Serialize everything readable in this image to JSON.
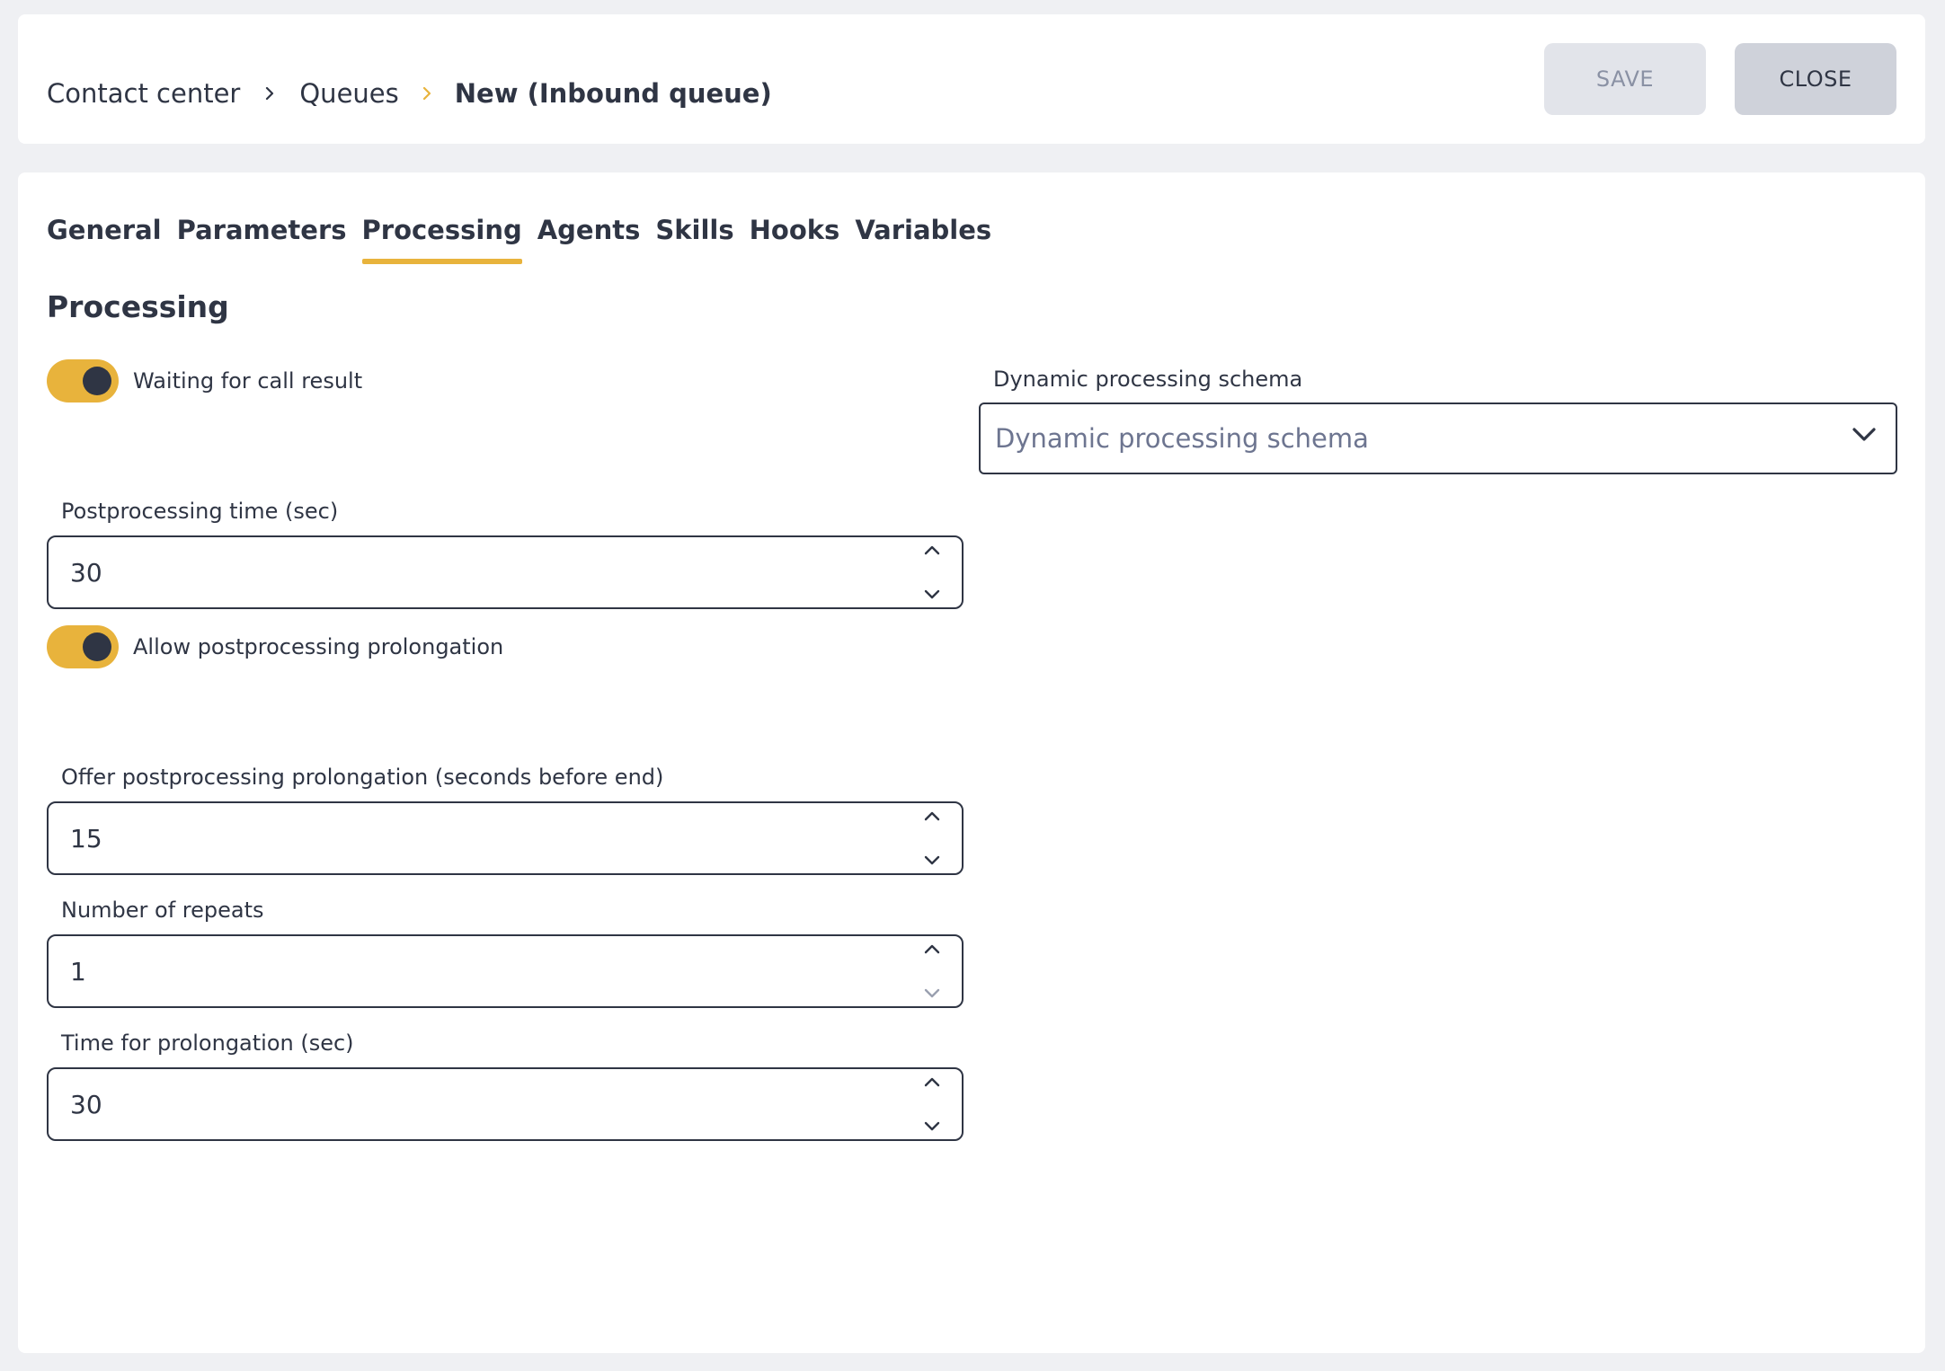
{
  "breadcrumb": {
    "items": [
      "Contact center",
      "Queues",
      "New (Inbound queue)"
    ]
  },
  "header": {
    "save_label": "SAVE",
    "close_label": "CLOSE"
  },
  "tabs": [
    {
      "label": "General",
      "active": false
    },
    {
      "label": "Parameters",
      "active": false
    },
    {
      "label": "Processing",
      "active": true
    },
    {
      "label": "Agents",
      "active": false
    },
    {
      "label": "Skills",
      "active": false
    },
    {
      "label": "Hooks",
      "active": false
    },
    {
      "label": "Variables",
      "active": false
    }
  ],
  "processing": {
    "title": "Processing",
    "waiting_toggle": {
      "label": "Waiting for call result",
      "on": true
    },
    "dynamic_schema": {
      "label": "Dynamic processing schema",
      "placeholder": "Dynamic processing schema"
    },
    "postprocessing_time": {
      "label": "Postprocessing time (sec)",
      "value": "30"
    },
    "allow_prolongation_toggle": {
      "label": "Allow postprocessing prolongation",
      "on": true
    },
    "offer_prolongation": {
      "label": "Offer postprocessing prolongation (seconds before end)",
      "value": "15"
    },
    "repeats": {
      "label": "Number of repeats",
      "value": "1"
    },
    "prolongation_time": {
      "label": "Time for prolongation (sec)",
      "value": "30"
    }
  },
  "colors": {
    "accent": "#e8b33c",
    "text": "#2f3544",
    "background": "#eff0f3"
  },
  "icons": {
    "breadcrumb_separator": "chevron-right-icon",
    "stepper_up": "chevron-up-icon",
    "stepper_down": "chevron-down-icon",
    "select_open": "chevron-down-icon"
  }
}
